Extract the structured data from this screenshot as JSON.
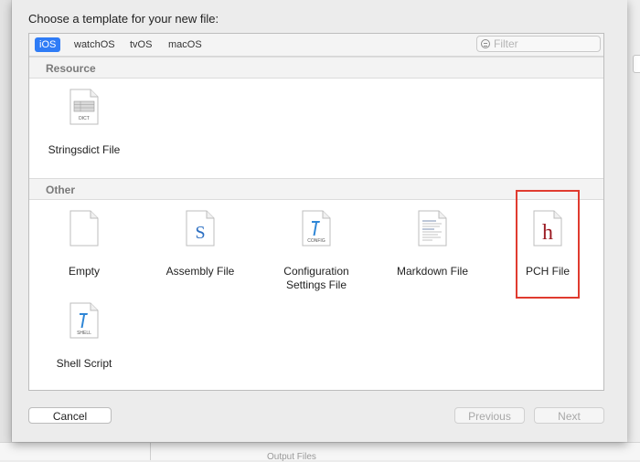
{
  "dialog": {
    "title": "Choose a template for your new file:",
    "platform_tabs": [
      {
        "label": "iOS",
        "selected": true
      },
      {
        "label": "watchOS",
        "selected": false
      },
      {
        "label": "tvOS",
        "selected": false
      },
      {
        "label": "macOS",
        "selected": false
      }
    ],
    "filter": {
      "placeholder": "Filter",
      "value": ""
    },
    "sections": [
      {
        "name": "Resource",
        "items": [
          {
            "label": "Stringsdict File",
            "icon": "dict-file-icon",
            "icon_text": "DICT"
          }
        ]
      },
      {
        "name": "Other",
        "items": [
          {
            "label": "Empty",
            "icon": "empty-file-icon"
          },
          {
            "label": "Assembly File",
            "icon": "assembly-file-icon",
            "glyph": "S"
          },
          {
            "label": "Configuration Settings File",
            "icon": "config-file-icon",
            "icon_text": "CONFIG"
          },
          {
            "label": "Markdown File",
            "icon": "markdown-file-icon"
          },
          {
            "label": "PCH File",
            "icon": "pch-file-icon",
            "glyph": "h",
            "highlighted": true
          },
          {
            "label": "Shell Script",
            "icon": "shell-script-icon",
            "icon_text": "SHELL"
          }
        ]
      }
    ],
    "buttons": {
      "cancel": "Cancel",
      "previous": "Previous",
      "next": "Next"
    }
  },
  "background": {
    "bottom_hint": "Output Files"
  },
  "colors": {
    "tab_selected": "#2f7cf6",
    "highlight_outline": "#e03b2f",
    "pch_glyph": "#9b1b23",
    "assembly_glyph": "#2c6fc2"
  }
}
